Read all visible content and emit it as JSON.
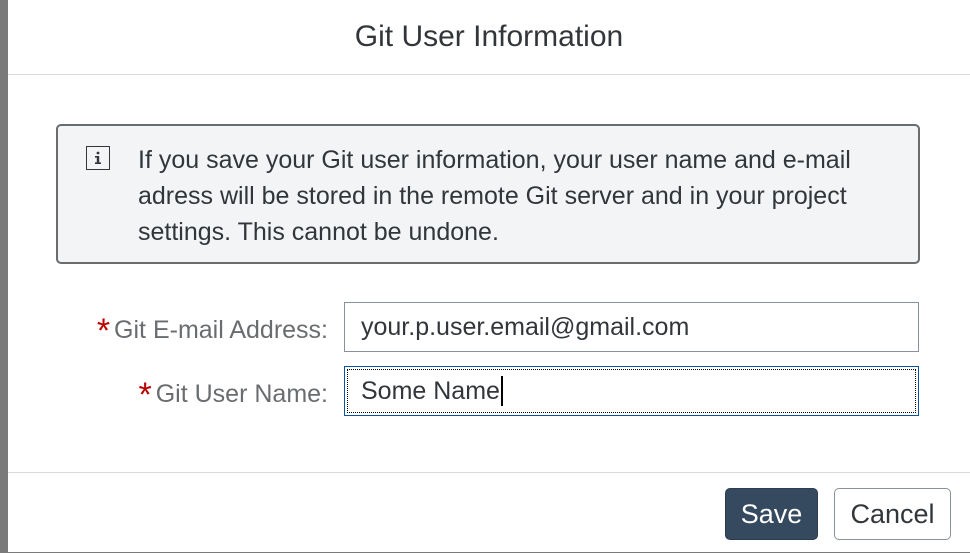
{
  "dialog": {
    "title": "Git User Information",
    "info_icon": "info-icon",
    "info_text": "If you save your Git user information, your user name and e-mail adress will be stored in the remote Git server and in your project settings. This cannot be undone."
  },
  "form": {
    "required_marker": "*",
    "email_label": "Git E-mail Address:",
    "email_value": "your.p.user.email@gmail.com",
    "username_label": "Git User Name:",
    "username_value": "Some Name"
  },
  "footer": {
    "save_label": "Save",
    "cancel_label": "Cancel"
  },
  "colors": {
    "primary_button": "#354a5f",
    "required": "#bb0000"
  }
}
